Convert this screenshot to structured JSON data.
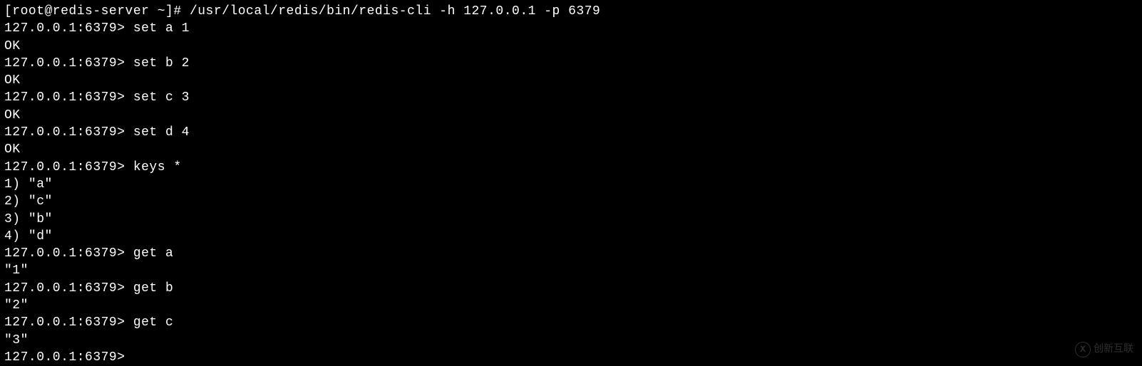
{
  "terminal": {
    "lines": [
      "[root@redis-server ~]# /usr/local/redis/bin/redis-cli -h 127.0.0.1 -p 6379",
      "127.0.0.1:6379> set a 1",
      "OK",
      "127.0.0.1:6379> set b 2",
      "OK",
      "127.0.0.1:6379> set c 3",
      "OK",
      "127.0.0.1:6379> set d 4",
      "OK",
      "127.0.0.1:6379> keys *",
      "1) \"a\"",
      "2) \"c\"",
      "3) \"b\"",
      "4) \"d\"",
      "127.0.0.1:6379> get a",
      "\"1\"",
      "127.0.0.1:6379> get b",
      "\"2\"",
      "127.0.0.1:6379> get c",
      "\"3\"",
      "127.0.0.1:6379> "
    ]
  },
  "watermark": {
    "text": "创新互联",
    "icon": "X"
  }
}
